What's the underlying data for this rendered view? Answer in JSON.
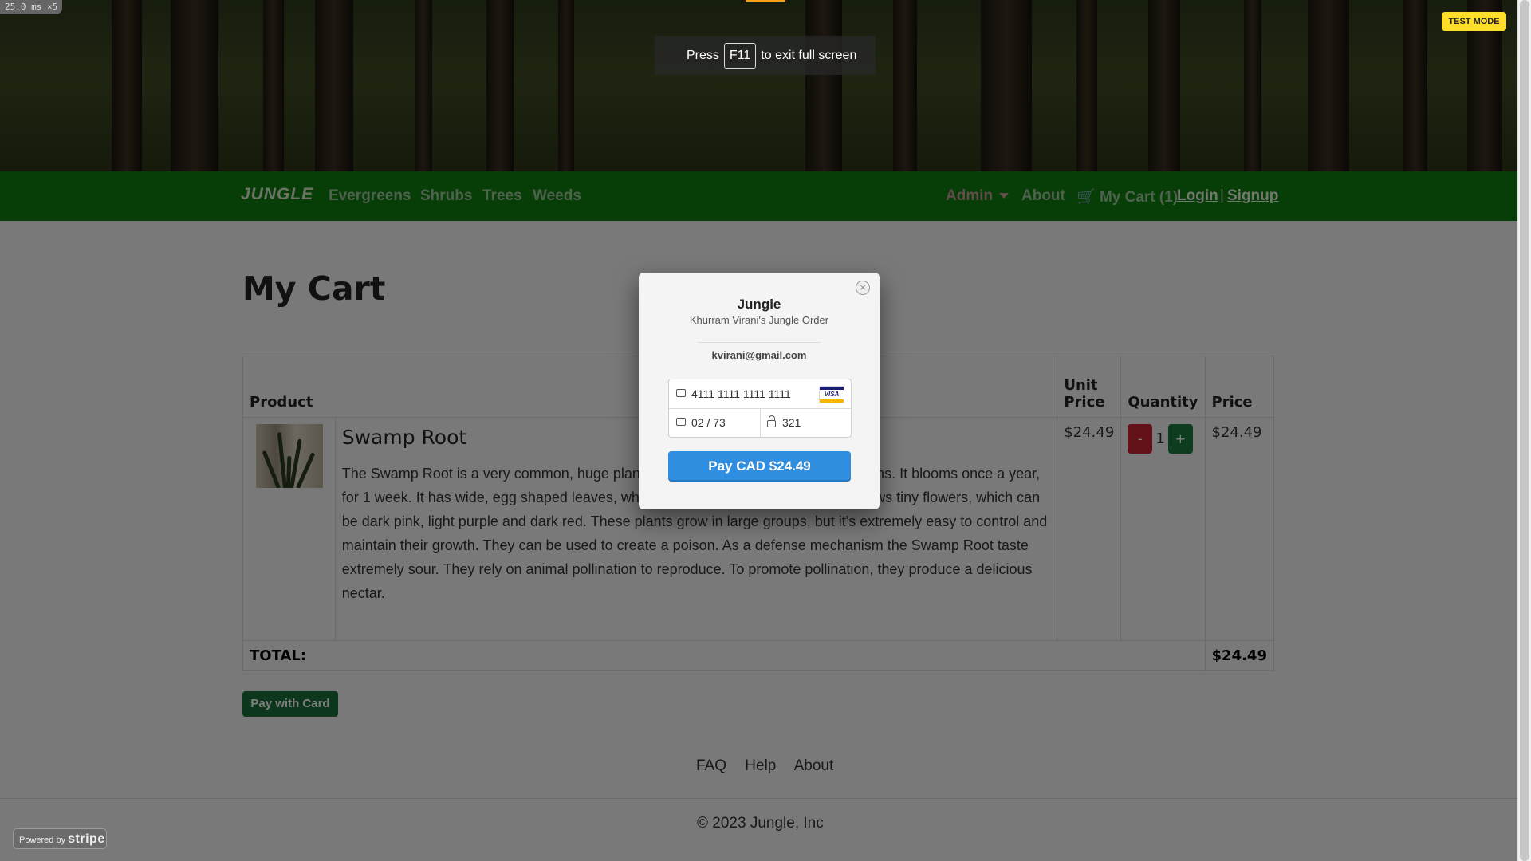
{
  "app": {
    "brand": "JUNGLE",
    "nav": {
      "categories": [
        "Evergreens",
        "Shrubs",
        "Trees",
        "Weeds"
      ],
      "admin": "Admin",
      "about": "About",
      "cart": "My Cart (1)",
      "login": "Login",
      "separator": "|",
      "signup": "Signup"
    }
  },
  "page_title": "My Cart",
  "table": {
    "headers": {
      "product": "Product",
      "unit_price": "Unit Price",
      "quantity": "Quantity",
      "price": "Price"
    },
    "rows": [
      {
        "name": "Swamp Root",
        "description": "The Swamp Root is a very common, huge plant. It can be found in some tropic regions. It blooms once a year, for 1 week. It has wide, egg shaped leaves, which are usually blue-green. It also grows tiny flowers, which can be dark pink, light purple and dark red. These plants grow in large groups, but it's extremely easy to control and maintain their growth. They can be used to create a poison. As a defense mechanism the Swamp Root taste extremely sour. They rely on animal pollination to reproduce. To promote pollination, they produce a delicious nectar.",
        "unit_price": "$24.49",
        "quantity": "1",
        "minus": "-",
        "plus": "+",
        "price": "$24.49"
      }
    ],
    "total_label": "TOTAL:",
    "total_value": "$24.49"
  },
  "pay_button": "Pay with Card",
  "footer": {
    "links": [
      "FAQ",
      "Help",
      "About"
    ],
    "copyright": "© 2023 Jungle, Inc"
  },
  "overlay": {
    "perf": "25.0 ms ×5",
    "test_mode": "TEST MODE",
    "fullscreen": {
      "press": "Press",
      "key": "F11",
      "rest": "to exit full screen"
    },
    "stripe": {
      "powered": "Powered by",
      "brand": "stripe"
    }
  },
  "checkout": {
    "close": "×",
    "title": "Jungle",
    "subtitle": "Khurram Virani's Jungle Order",
    "email": "kvirani@gmail.com",
    "card_number": "4111 1111 1111 1111",
    "card_brand": "VISA",
    "expiry": "02 / 73",
    "cvc": "321",
    "pay_label": "Pay CAD $24.49"
  },
  "colors": {
    "navbar": "#0f7a0f",
    "pay_blue": "#2f8ee0",
    "pay_green": "#1b6e3a",
    "minus_red": "#c52333",
    "plus_green": "#1b7a3d",
    "test_mode_yellow": "#ffde2a"
  }
}
